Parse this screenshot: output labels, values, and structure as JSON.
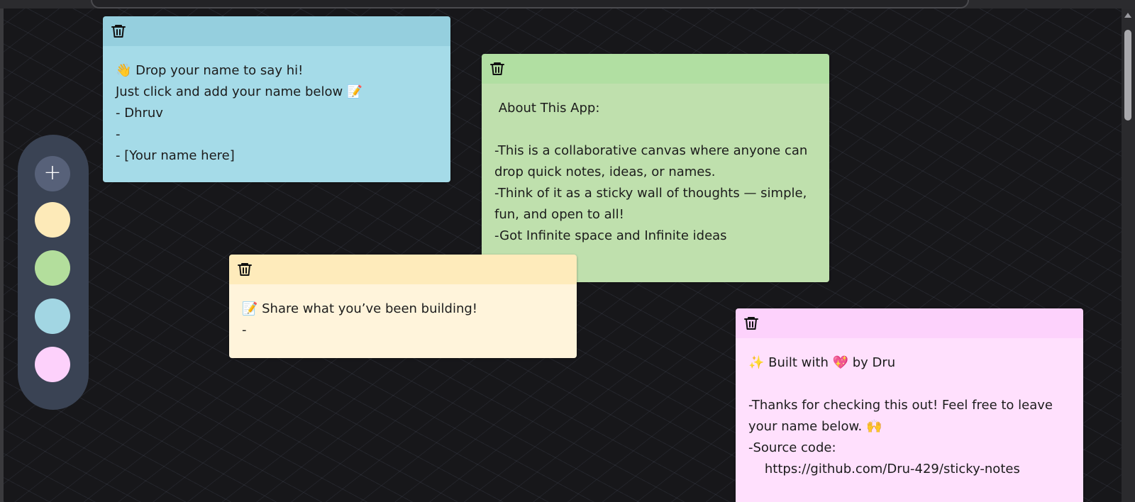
{
  "palette": {
    "add_label": "+",
    "swatches": [
      {
        "name": "yellow",
        "color": "#fdeab8"
      },
      {
        "name": "green",
        "color": "#b3de9c"
      },
      {
        "name": "blue",
        "color": "#a2d6e3"
      },
      {
        "name": "pink",
        "color": "#fdd1fb"
      }
    ]
  },
  "icons": {
    "delete": "trash-icon",
    "add": "plus-icon"
  },
  "notes": [
    {
      "header_color": "#95cfde",
      "body_color": "#a5dbe8",
      "text": "👋 Drop your name to say hi!\nJust click and add your name below 📝\n- Dhruv\n-\n- [Your name here]"
    },
    {
      "header_color": "#b1dfa2",
      "body_color": "#bfe0ad",
      "text": " About This App:\n\n-This is a collaborative canvas where anyone can drop quick notes, ideas, or names.\n-Think of it as a sticky wall of thoughts — simple, fun, and open to all!\n-Got Infinite space and Infinite ideas"
    },
    {
      "header_color": "#feebbb",
      "body_color": "#fff4db",
      "text": "📝 Share what you’ve been building!\n-"
    },
    {
      "header_color": "#fdd2fc",
      "body_color": "#ffe0fd",
      "text": "✨ Built with 💖 by Dru\n\n-Thanks for checking this out! Feel free to leave your name below. 🙌\n-Source code:\n    https://github.com/Dru-429/sticky-notes"
    }
  ]
}
